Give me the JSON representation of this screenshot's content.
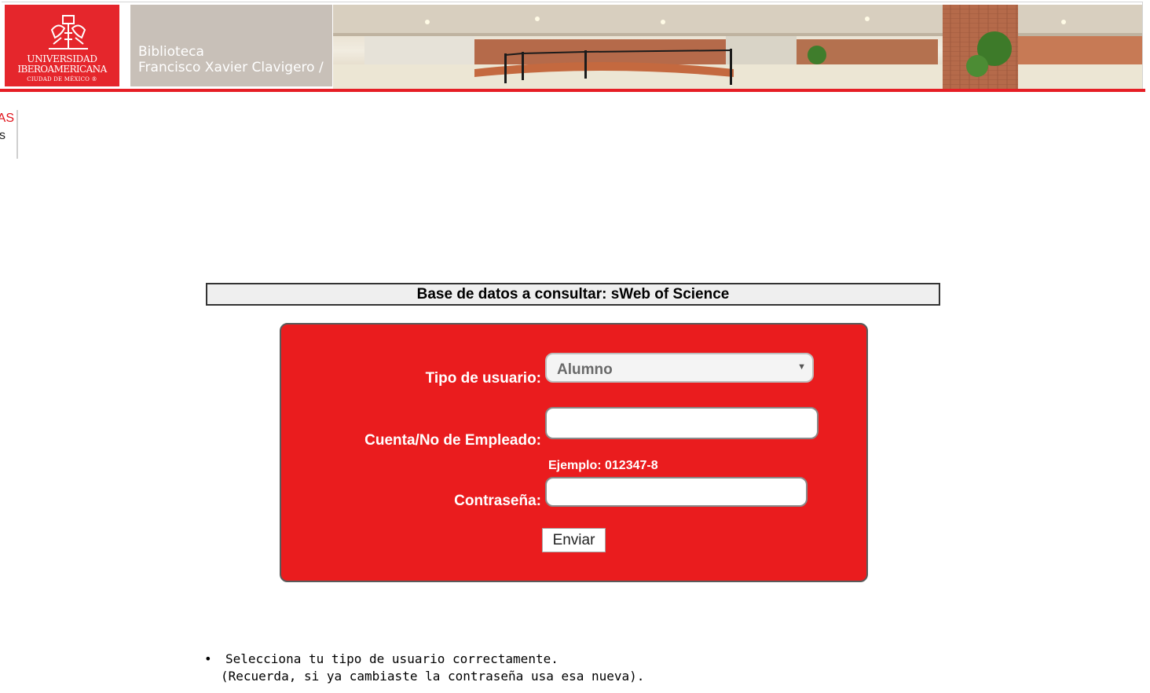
{
  "header": {
    "logo": {
      "line1": "UNIVERSIDAD",
      "line2": "IBEROAMERICANA",
      "line3": "CIUDAD DE MÉXICO ®"
    },
    "library": {
      "line1": "Biblioteca",
      "line2": "Francisco Xavier Clavigero /"
    },
    "colors": {
      "brand_red": "#e5262c",
      "accent_line": "#e61e25"
    }
  },
  "side_nav": {
    "item1": "AS",
    "item2": "s"
  },
  "database_bar": {
    "title": "Base de datos a consultar: sWeb of Science"
  },
  "login_form": {
    "tipo_label": "Tipo de usuario:",
    "tipo_value": "Alumno",
    "tipo_arrow": "▼",
    "cuenta_label": "Cuenta/No de Empleado:",
    "cuenta_value": "",
    "cuenta_hint": "Ejemplo: 012347-8",
    "password_label": "Contraseña:",
    "password_value": "",
    "submit_label": "Enviar",
    "panel_color": "#ea1c1e"
  },
  "notes": {
    "bullet": "•",
    "line1": "Selecciona tu tipo de usuario correctamente.",
    "line2": "(Recuerda, si ya cambiaste la contraseña usa esa nueva)."
  }
}
